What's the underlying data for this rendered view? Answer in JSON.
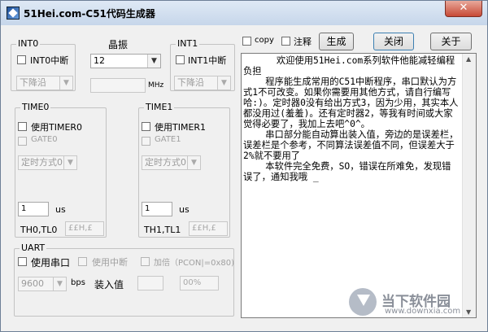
{
  "window": {
    "title": "51Hei.com-C51代码生成器",
    "close_glyph": "✕"
  },
  "int0": {
    "group_title": "INT0",
    "checkbox_label": "INT0中断",
    "trigger_select": "下降沿"
  },
  "crystal": {
    "label": "晶振",
    "value": "12",
    "unit": "MHz"
  },
  "int1": {
    "group_title": "INT1",
    "checkbox_label": "INT1中断",
    "trigger_select": "下降沿"
  },
  "timer0": {
    "group_title": "TIME0",
    "enable_label": "使用TIMER0",
    "gate_label": "GATE0",
    "mode_select": "定时方式0",
    "time_value": "1",
    "time_unit": "us",
    "reg_label": "TH0,TL0",
    "reg_value": "££H,££H"
  },
  "timer1": {
    "group_title": "TIME1",
    "enable_label": "使用TIMER1",
    "gate_label": "GATE1",
    "mode_select": "定时方式0",
    "time_value": "1",
    "time_unit": "us",
    "reg_label": "TH1,TL1",
    "reg_value": "££H,££H"
  },
  "uart": {
    "group_title": "UART",
    "use_serial_label": "使用串口",
    "use_interrupt_label": "使用中断",
    "double_label": "加倍（PCON|=0x80)",
    "baud_select": "9600",
    "baud_unit": "bps",
    "load_label": "装入值",
    "load_value": "",
    "error_value": "00%"
  },
  "toolbar": {
    "copy_label": "copy",
    "comment_label": "注释",
    "generate_button": "生成",
    "close_button": "关闭",
    "about_button": "关于"
  },
  "editor": {
    "text": "      欢迎使用51Hei.com系列软件他能减轻编程负担\n    程序能生成常用的C51中断程序，串口默认为方式1不可改变。如果你需要用其他方式，请自行编写哈:)。定时器0没有给出方式3，因为少用，其实本人都没用过(羞羞)。还有定时器2，等我有时间或大家觉得必要了，我加上去吧^0^。\n    串口部分能自动算出装入值，旁边的是误差栏，误差栏是个参考，不同算法误差值不同，但误差大于2%就不要用了\n    本软件完全免费，SO，错误在所难免，发现错误了，通知我哦 _"
  },
  "watermark": {
    "text": "当下软件园",
    "url": "www.downxia.com"
  }
}
